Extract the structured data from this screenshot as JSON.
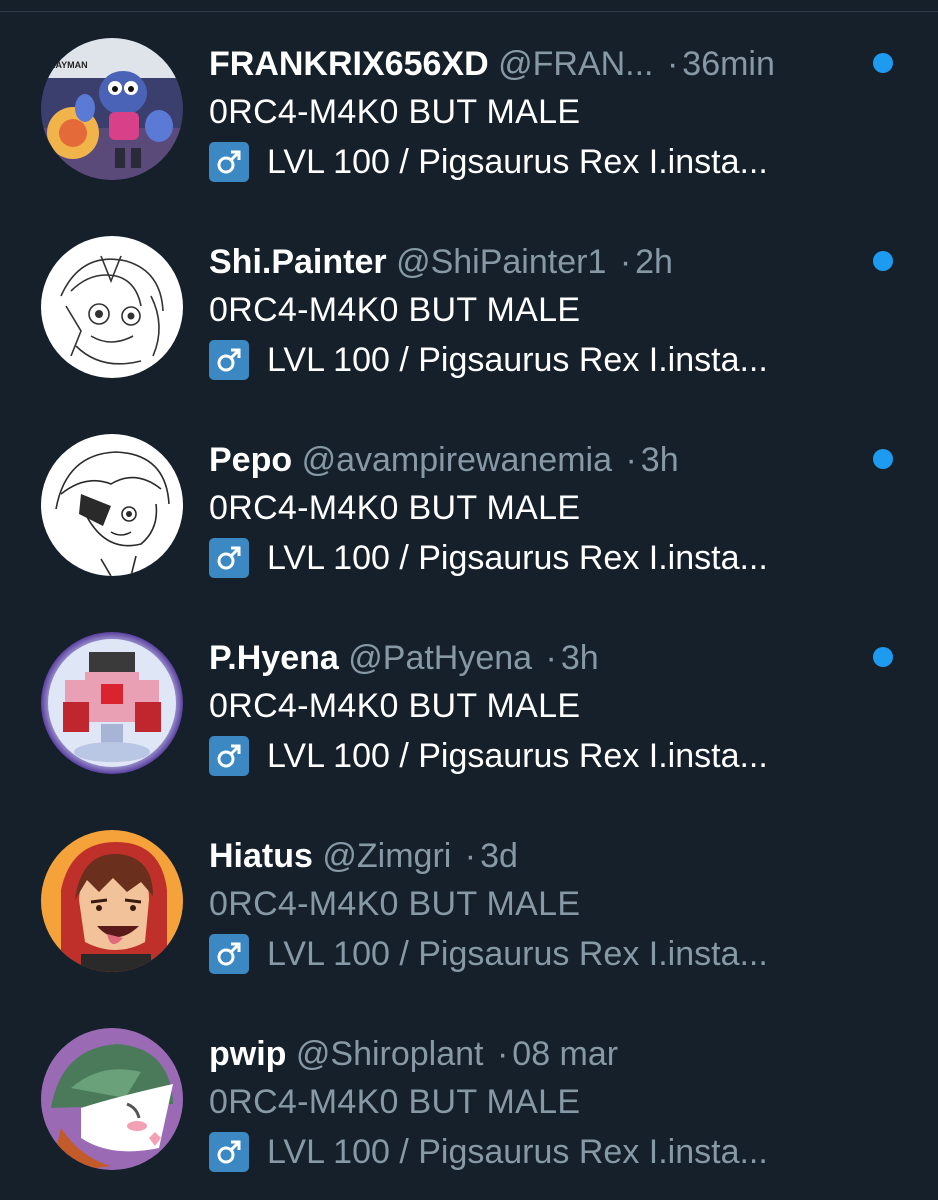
{
  "colors": {
    "background": "#15202b",
    "primary_text": "#ffffff",
    "secondary_text": "#8899a6",
    "unread_dot": "#1d9bf0",
    "gender_badge": "#3b88c3"
  },
  "conversations": [
    {
      "display_name": "FRANKRIX656XD",
      "handle": "@FRAN...",
      "separator": "·",
      "time": "36min",
      "line2": "0RC4-M4K0 BUT MALE",
      "line3": "LVL 100 / Pigsaurus Rex I.insta...",
      "gender_icon": "male-sign-icon",
      "unread": true,
      "avatar_text": "RAYMAN"
    },
    {
      "display_name": "Shi.Painter",
      "handle": "@ShiPainter1",
      "separator": "·",
      "time": "2h",
      "line2": "0RC4-M4K0 BUT MALE",
      "line3": "LVL 100 / Pigsaurus Rex I.insta...",
      "gender_icon": "male-sign-icon",
      "unread": true
    },
    {
      "display_name": "Pepo",
      "handle": "@avampirewanemia",
      "separator": "·",
      "time": "3h",
      "line2": "0RC4-M4K0 BUT MALE",
      "line3": "LVL 100 / Pigsaurus Rex I.insta...",
      "gender_icon": "male-sign-icon",
      "unread": true
    },
    {
      "display_name": "P.Hyena",
      "handle": "@PatHyena",
      "separator": "·",
      "time": "3h",
      "line2": "0RC4-M4K0 BUT MALE",
      "line3": "LVL 100 / Pigsaurus Rex I.insta...",
      "gender_icon": "male-sign-icon",
      "unread": true
    },
    {
      "display_name": "Hiatus",
      "handle": "@Zimgri",
      "separator": "·",
      "time": "3d",
      "line2": "0RC4-M4K0 BUT MALE",
      "line3": "LVL 100 / Pigsaurus Rex I.insta...",
      "gender_icon": "male-sign-icon",
      "unread": false
    },
    {
      "display_name": "pwip",
      "handle": "@Shiroplant",
      "separator": "·",
      "time": "08 mar",
      "line2": "0RC4-M4K0 BUT MALE",
      "line3": "LVL 100 / Pigsaurus Rex I.insta...",
      "gender_icon": "male-sign-icon",
      "unread": false
    }
  ]
}
